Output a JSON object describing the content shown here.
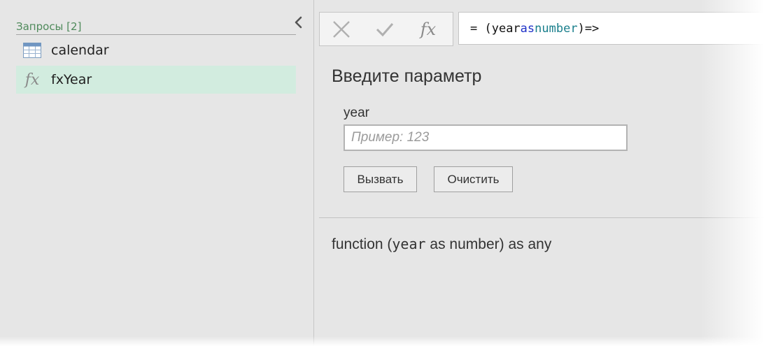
{
  "queries_pane": {
    "header": "Запросы [2]",
    "items": [
      {
        "label": "calendar",
        "icon": "table-icon",
        "selected": false
      },
      {
        "label": "fxYear",
        "icon": "function-icon",
        "selected": true
      }
    ]
  },
  "formula_bar": {
    "fx_label": "fx",
    "formula": {
      "prefix": "= (",
      "param": "year",
      "as_kw": "as",
      "type_kw": "number",
      "suffix": ")=>"
    }
  },
  "parameter_panel": {
    "heading": "Введите параметр",
    "param_label": "year",
    "input_placeholder": "Пример: 123",
    "input_value": "",
    "invoke_label": "Вызвать",
    "clear_label": "Очистить"
  },
  "signature": {
    "prefix": "function (",
    "param": "year",
    "rest": " as number) as any"
  },
  "colors": {
    "selected_row": "#d2ecdf",
    "header_text": "#4f8a5b",
    "keyword_as": "#1f32c8",
    "keyword_type": "#1a7f8c"
  }
}
